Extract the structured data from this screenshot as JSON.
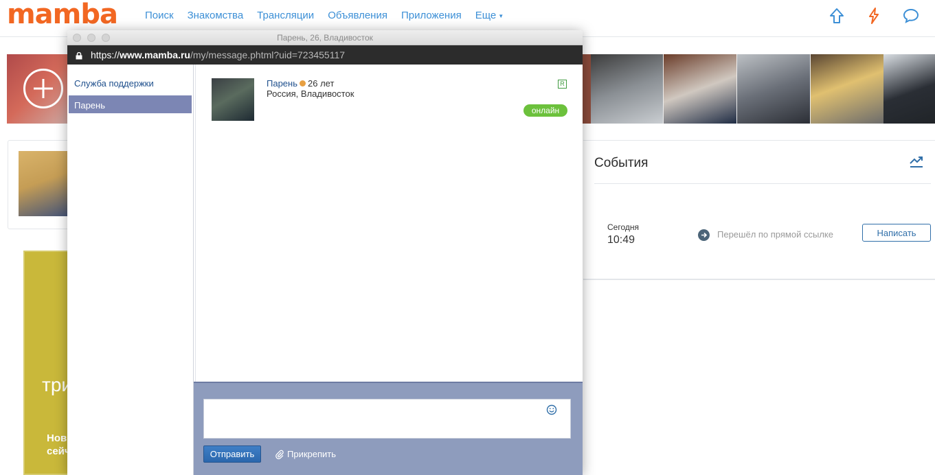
{
  "header": {
    "logo": "mamba",
    "nav": [
      "Поиск",
      "Знакомства",
      "Трансляции",
      "Объявления",
      "Приложения",
      "Еще"
    ],
    "icons": [
      "upload-arrow-icon",
      "lightning-icon",
      "chat-bubble-icon"
    ]
  },
  "popup": {
    "window_title": "Парень, 26, Владивосток",
    "url_scheme": "https://",
    "url_host": "www.mamba.ru",
    "url_path": "/my/message.phtml?uid=723455117",
    "contacts": [
      "Служба поддержки",
      "Парень"
    ],
    "chat_user": {
      "name": "Парень",
      "age": "26 лет",
      "location": "Россия, Владивосток",
      "badge": "R",
      "status": "онлайн"
    },
    "composer": {
      "message_value": "",
      "send_label": "Отправить",
      "attach_label": "Прикрепить"
    }
  },
  "events": {
    "title": "События",
    "day": "Сегодня",
    "time": "10:49",
    "action": "Перешёл по прямой ссылке",
    "button": "Написать"
  },
  "ad": {
    "big_text": "три",
    "small_line1": "Нов",
    "small_line2": "сейча"
  },
  "colors": {
    "brand": "#f26722",
    "link": "#3c8fd6",
    "active_contact": "#7c86b4",
    "composer_bg": "#8e9cbd",
    "online": "#6cc13c"
  }
}
